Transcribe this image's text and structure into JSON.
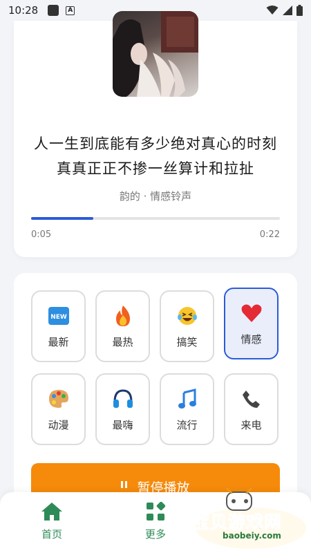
{
  "status_bar": {
    "time": "10:28"
  },
  "player": {
    "title_line1": "人一生到底能有多少绝对真心的时刻",
    "title_line2": "真真正正不掺一丝算计和拉扯",
    "subtitle": "韵的 · 情感铃声",
    "current_time": "0:05",
    "total_time": "0:22",
    "progress": 0.25,
    "accent": "#2a5bd7"
  },
  "categories": [
    {
      "label": "最新",
      "icon": "new-icon",
      "selected": false
    },
    {
      "label": "最热",
      "icon": "fire-icon",
      "selected": false
    },
    {
      "label": "搞笑",
      "icon": "laughing-face-icon",
      "selected": false
    },
    {
      "label": "情感",
      "icon": "heart-icon",
      "selected": true
    },
    {
      "label": "动漫",
      "icon": "palette-icon",
      "selected": false
    },
    {
      "label": "最嗨",
      "icon": "headphones-icon",
      "selected": false
    },
    {
      "label": "流行",
      "icon": "music-note-icon",
      "selected": false
    },
    {
      "label": "来电",
      "icon": "phone-icon",
      "selected": false
    }
  ],
  "pause_button": {
    "label": "暂停播放",
    "color": "#f58a0b"
  },
  "bottom_nav": {
    "home_label": "首页",
    "more_label": "更多",
    "color": "#2e8b57"
  },
  "watermark": {
    "text": "宝贝游戏网",
    "url": "baobeiy.com"
  }
}
